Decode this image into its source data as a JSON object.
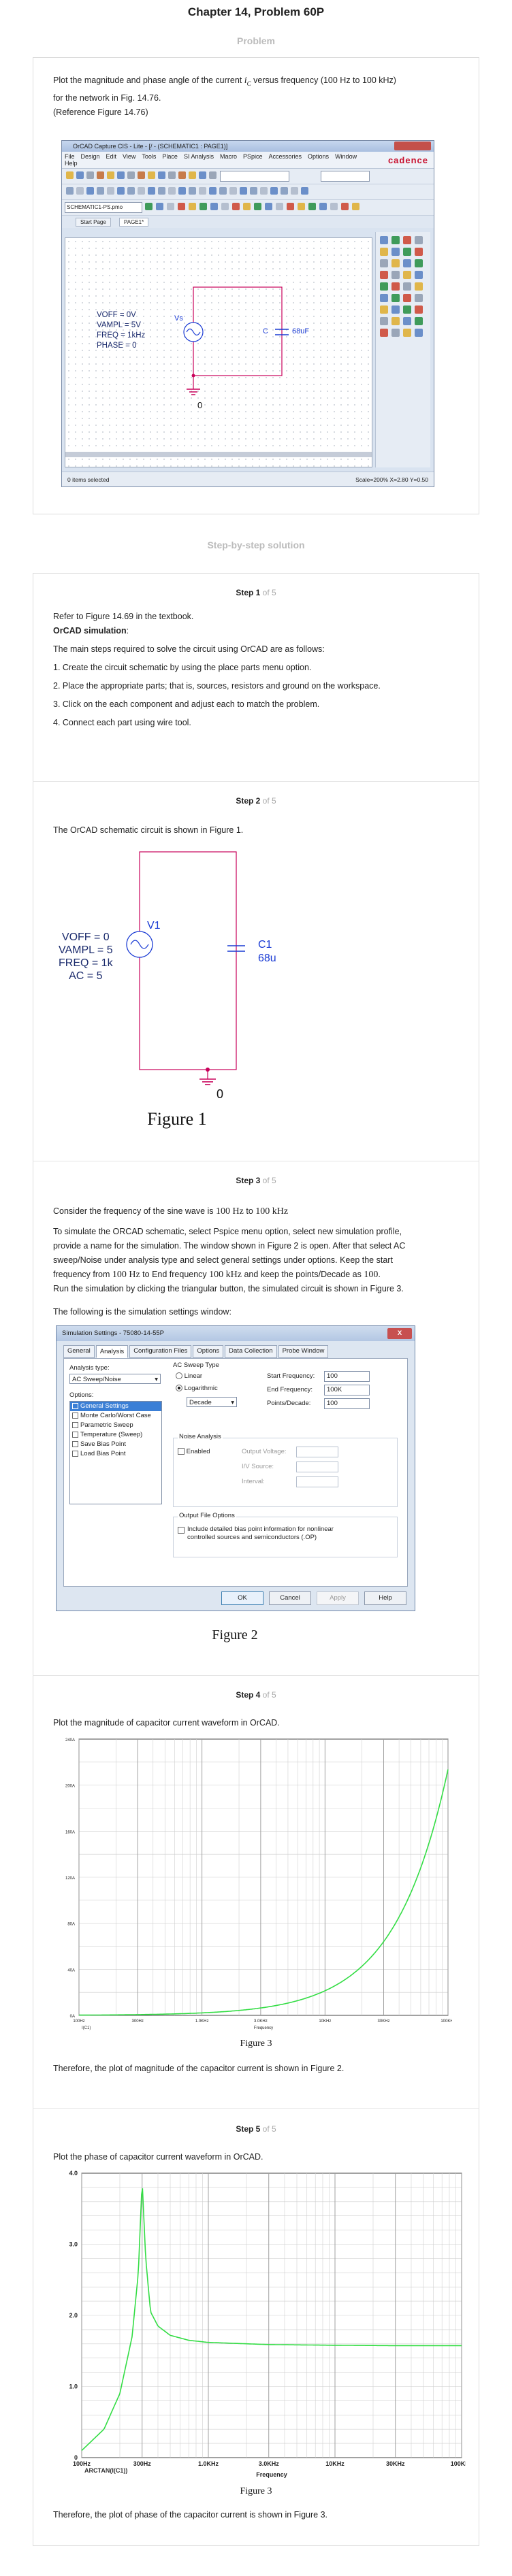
{
  "header": {
    "title": "Chapter 14, Problem 60P",
    "problem_label": "Problem"
  },
  "problem": {
    "line1_pre": "Plot the magnitude and phase angle of the current",
    "line1_var": "i",
    "line1_sub": "C",
    "line1_post": "versus frequency (100 Hz to 100 kHz)",
    "line2": "for the network in Fig. 14.76.",
    "line3": "(Reference Figure 14.76)"
  },
  "orcad": {
    "title": "OrCAD Capture CIS - Lite - [/ - (SCHEMATIC1 : PAGE1)]",
    "menu": [
      "File",
      "Design",
      "Edit",
      "View",
      "Tools",
      "Place",
      "SI Analysis",
      "Macro",
      "PSpice",
      "Accessories",
      "Options",
      "Window",
      "Help"
    ],
    "brand": "cadence",
    "profile": "SCHEMATIC1-PS.pmo",
    "tabs": [
      "Start Page",
      "PAGE1*"
    ],
    "params": [
      "VOFF = 0V",
      "VAMPL = 5V",
      "FREQ = 1kHz",
      "PHASE = 0"
    ],
    "source_label": "Vs",
    "cap_label": "C",
    "cap_value": "68uF",
    "ground_label": "0",
    "status_left": "0 items selected",
    "status_right": "Scale=200%   X=2.80  Y=0.50"
  },
  "solution_heading": "Step-by-step solution",
  "steps": {
    "of_label": "of 5",
    "s1": {
      "label": "Step 1",
      "p1": "Refer to Figure 14.69 in the textbook.",
      "p2": "OrCAD simulation",
      "p2_colon": ":",
      "p3": "The main steps required to solve the circuit using OrCAD are as follows:",
      "items": [
        "1. Create the circuit schematic by using the place parts menu option.",
        "2. Place the appropriate parts; that is, sources, resistors and ground on the workspace.",
        "3. Click on the each component and adjust each to match the problem.",
        "4. Connect each part using wire tool."
      ]
    },
    "s2": {
      "label": "Step 2",
      "p1": "The OrCAD schematic circuit is shown in Figure 1.",
      "params": [
        "VOFF = 0",
        "VAMPL = 5",
        "FREQ = 1k",
        "AC = 5"
      ],
      "source_label": "V1",
      "cap_label": "C1",
      "cap_value": "68u",
      "ground_label": "0",
      "caption": "Figure 1"
    },
    "s3": {
      "label": "Step 3",
      "p1_pre": "Consider the frequency of the sine wave is",
      "p1_f1": "100 Hz",
      "p1_to": "to",
      "p1_f2": "100 kHz",
      "p2_lines": [
        "To simulate the ORCAD schematic, select Pspice menu option, select new simulation profile,",
        "provide a name for the simulation. The window shown in Figure 2 is open. After that select AC",
        "sweep/Noise under analysis type and select general settings under options. Keep the start"
      ],
      "p2_l4_a": "frequency from",
      "p2_l4_f1": "100 Hz",
      "p2_l4_b": "to End frequency",
      "p2_l4_f2": "100 kHz",
      "p2_l4_c": "and keep the points/Decade as",
      "p2_l4_n": "100",
      "p2_l4_d": ".",
      "p2_l5": "Run the simulation by clicking the triangular button, the simulated circuit is shown in Figure 3.",
      "p3": "The following is the simulation settings window:",
      "caption": "Figure 2",
      "dialog": {
        "title": "Simulation Settings - 75080-14-55P",
        "close": "X",
        "tabs": [
          "General",
          "Analysis",
          "Configuration Files",
          "Options",
          "Data Collection",
          "Probe Window"
        ],
        "analysis_type_label": "Analysis type:",
        "analysis_type_value": "AC Sweep/Noise",
        "options_label": "Options:",
        "options": [
          "General Settings",
          "Monte Carlo/Worst Case",
          "Parametric Sweep",
          "Temperature (Sweep)",
          "Save Bias Point",
          "Load Bias Point"
        ],
        "ac_sweep_title": "AC Sweep Type",
        "linear": "Linear",
        "log": "Logarithmic",
        "decade": "Decade",
        "start_label": "Start Frequency:",
        "start_value": "100",
        "end_label": "End Frequency:",
        "end_value": "100K",
        "points_label": "Points/Decade:",
        "points_value": "100",
        "noise_title": "Noise Analysis",
        "enabled": "Enabled",
        "output_voltage": "Output Voltage:",
        "iv_source": "I/V Source:",
        "interval": "Interval:",
        "output_file_title": "Output File Options",
        "output_file_text1": "Include detailed bias point information for nonlinear",
        "output_file_text2": "controlled sources and semiconductors (.OP)",
        "buttons": [
          "OK",
          "Cancel",
          "Apply",
          "Help"
        ]
      }
    },
    "s4": {
      "label": "Step 4",
      "p1": "Plot the magnitude of capacitor current waveform in OrCAD.",
      "caption": "Figure 3",
      "p2": "Therefore, the plot of magnitude of the capacitor current is shown in Figure 2."
    },
    "s5": {
      "label": "Step 5",
      "p1": "Plot the phase of capacitor current waveform in OrCAD.",
      "caption": "Figure 3",
      "p2": "Therefore, the plot of phase of the capacitor current is shown in Figure 3."
    }
  },
  "chart_data": [
    {
      "type": "line",
      "title": "",
      "xscale": "log",
      "xlim": [
        100,
        100000
      ],
      "ylim": [
        0,
        240
      ],
      "x_ticks": [
        "100Hz",
        "300Hz",
        "1.0KHz",
        "3.0KHz",
        "10KHz",
        "30KHz",
        "100KHz"
      ],
      "y_ticks": [
        "0A",
        "40A",
        "80A",
        "120A",
        "160A",
        "200A",
        "240A"
      ],
      "xlabel": "Frequency",
      "legend": "I(C1)",
      "series": [
        {
          "x": [
            100,
            300,
            1000,
            3000,
            10000,
            30000,
            100000
          ],
          "y": [
            0.21,
            0.64,
            2.1,
            6.4,
            21.4,
            64.1,
            213.6
          ]
        }
      ]
    },
    {
      "type": "line",
      "title": "",
      "xscale": "log",
      "xlim": [
        100,
        100000
      ],
      "ylim": [
        0,
        4.0
      ],
      "x_ticks": [
        "100Hz",
        "300Hz",
        "1.0KHz",
        "3.0KHz",
        "10KHz",
        "30KHz",
        "100KHz"
      ],
      "y_ticks": [
        "0",
        "1.0",
        "2.0",
        "3.0",
        "4.0"
      ],
      "xlabel": "Frequency",
      "legend": "ARCTAN(I(C1))",
      "series": [
        {
          "x": [
            100,
            150,
            200,
            250,
            280,
            300,
            320,
            350,
            400,
            500,
            700,
            1000,
            3000,
            10000,
            30000,
            100000
          ],
          "y": [
            0.1,
            0.4,
            0.9,
            1.7,
            2.6,
            3.9,
            2.8,
            2.05,
            1.85,
            1.72,
            1.65,
            1.62,
            1.59,
            1.58,
            1.575,
            1.575
          ]
        }
      ]
    }
  ],
  "colors": {
    "trace": "#33dd44",
    "schematic_wire": "#c8005a",
    "schematic_blue": "#1a3bd4"
  }
}
